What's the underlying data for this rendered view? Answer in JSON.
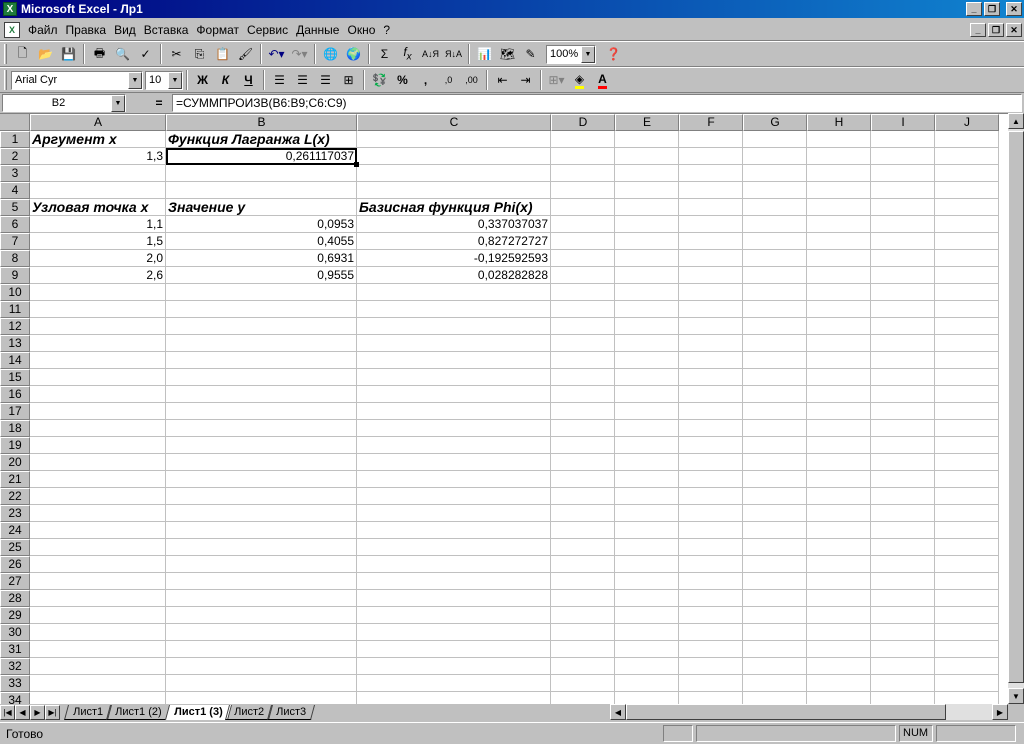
{
  "window": {
    "title": "Microsoft Excel - Лр1"
  },
  "icons": {
    "app": "excel-icon",
    "minimize": "minimize-icon",
    "restore": "restore-icon",
    "close": "close-icon"
  },
  "menu": {
    "items": [
      "Файл",
      "Правка",
      "Вид",
      "Вставка",
      "Формат",
      "Сервис",
      "Данные",
      "Окно",
      "?"
    ]
  },
  "toolbar": {
    "zoom": "100%",
    "font_name": "Arial Cyr",
    "font_size": "10",
    "bold_label": "Ж",
    "italic_label": "К",
    "underline_label": "Ч",
    "percent_label": "%",
    "comma_label": ",",
    "inc_decimal_label": ",0",
    "dec_decimal_label": ",00"
  },
  "formula_bar": {
    "name_box": "B2",
    "equals": "=",
    "formula": "=СУММПРОИЗВ(B6:B9;C6:C9)"
  },
  "columns": [
    "A",
    "B",
    "C",
    "D",
    "E",
    "F",
    "G",
    "H",
    "I",
    "J"
  ],
  "cells": {
    "A1": "Аргумент x",
    "B1": "Функция Лагранжа L(x)",
    "A2": "1,3",
    "B2": "0,261117037",
    "A5": "Узловая точка x",
    "B5": "Значение y",
    "C5": "Базисная функция Phi(x)",
    "A6": "1,1",
    "B6": "0,0953",
    "C6": "0,337037037",
    "A7": "1,5",
    "B7": "0,4055",
    "C7": "0,827272727",
    "A8": "2,0",
    "B8": "0,6931",
    "C8": "-0,192592593",
    "A9": "2,6",
    "B9": "0,9555",
    "C9": "0,028282828"
  },
  "sheet_tabs": [
    "Лист1",
    "Лист1 (2)",
    "Лист1 (3)",
    "Лист2",
    "Лист3"
  ],
  "active_tab": "Лист1 (3)",
  "status": {
    "text": "Готово",
    "num": "NUM"
  }
}
